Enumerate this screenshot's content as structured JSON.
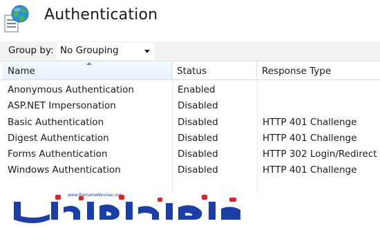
{
  "page": {
    "title": "Authentication"
  },
  "icons": {
    "app_icon": "globe-document-icon"
  },
  "toolbar": {
    "group_by_label": "Group by:",
    "group_by_value": "No Grouping"
  },
  "list": {
    "columns": [
      "Name",
      "Status",
      "Response Type"
    ],
    "sorted_column": "Name",
    "rows": [
      {
        "name": "Anonymous Authentication",
        "status": "Enabled",
        "response": ""
      },
      {
        "name": "ASP.NET Impersonation",
        "status": "Disabled",
        "response": ""
      },
      {
        "name": "Basic Authentication",
        "status": "Disabled",
        "response": "HTTP 401 Challenge"
      },
      {
        "name": "Digest Authentication",
        "status": "Disabled",
        "response": "HTTP 401 Challenge"
      },
      {
        "name": "Forms Authentication",
        "status": "Disabled",
        "response": "HTTP 302 Login/Redirect"
      },
      {
        "name": "Windows Authentication",
        "status": "Disabled",
        "response": "HTTP 401 Challenge"
      }
    ]
  },
  "watermark": {
    "url_text": "www.BamameNevisan.org",
    "brand_text": "برنامه نویسان",
    "primary_color": "#1b3fa6",
    "accent_color": "#e0202a"
  }
}
